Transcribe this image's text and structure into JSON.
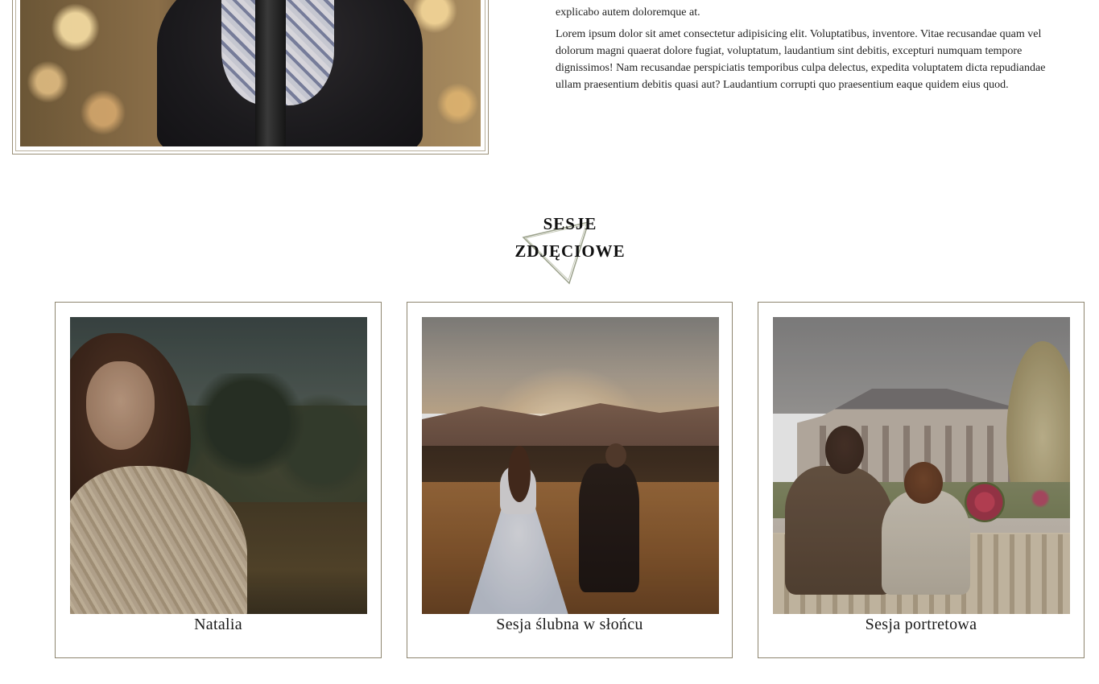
{
  "intro": {
    "partial_line": "explicabo autem doloremque at.",
    "paragraph": "Lorem ipsum dolor sit amet consectetur adipisicing elit. Voluptatibus, inventore. Vitae recusandae quam vel dolorum magni quaerat dolore fugiat, voluptatum, laudantium sint debitis, excepturi numquam tempore dignissimos! Nam recusandae perspiciatis temporibus culpa delectus, expedita voluptatem dicta repudiandae ullam praesentium debitis quasi aut? Laudantium corrupti quo praesentium eaque quidem eius quod."
  },
  "section": {
    "title_line1": "SESJE",
    "title_line2": "ZDJĘCIOWE"
  },
  "sessions": [
    {
      "caption": "Natalia"
    },
    {
      "caption": "Sesja ślubna w słońcu"
    },
    {
      "caption": "Sesja portretowa"
    }
  ],
  "colors": {
    "frame_border": "#8e856f",
    "text": "#111111",
    "background": "#ffffff"
  }
}
